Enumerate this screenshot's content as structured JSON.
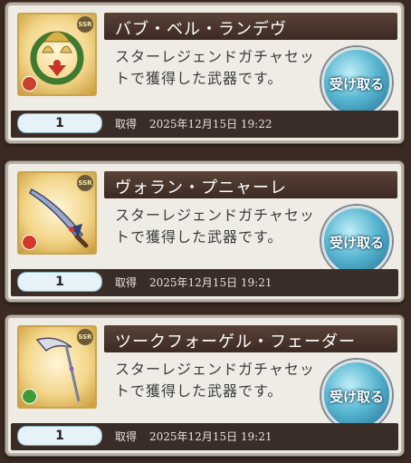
{
  "gifts": [
    {
      "name": "バブ・ベル・ランデヴ",
      "description": "スターレジェンドガチャセットで獲得した武器です。",
      "rarity": "SSR",
      "quantity": "1",
      "obtained_label": "取得",
      "date": "2025年12月15日 19:22",
      "receive_label": "受け取る",
      "icon": "bells-wreath-icon",
      "element_color": "#c9412b"
    },
    {
      "name": "ヴォラン・プニャーレ",
      "description": "スターレジェンドガチャセットで獲得した武器です。",
      "rarity": "SSR",
      "quantity": "1",
      "obtained_label": "取得",
      "date": "2025年12月15日 19:21",
      "receive_label": "受け取る",
      "icon": "dagger-icon",
      "element_color": "#d6352a"
    },
    {
      "name": "ツークフォーゲル・フェーダー",
      "description": "スターレジェンドガチャセットで獲得した武器です。",
      "rarity": "SSR",
      "quantity": "1",
      "obtained_label": "取得",
      "date": "2025年12月15日 19:21",
      "receive_label": "受け取る",
      "icon": "scythe-icon",
      "element_color": "#3f9a3a"
    }
  ]
}
